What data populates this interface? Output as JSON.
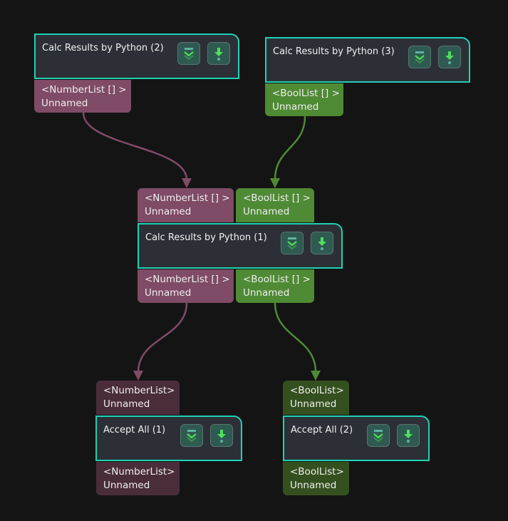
{
  "colors": {
    "background": "#141414",
    "node_fill": "#2c3036",
    "node_border": "#1fd1b5",
    "number_port": "#7f4b66",
    "bool_port": "#4f8a34",
    "number_port_muted": "#4a2d3a",
    "bool_port_muted": "#34501f",
    "number_edge": "#7f4b66",
    "bool_edge": "#4f8a34",
    "button_fill": "#2f5a51",
    "icon_green": "#4ee05a"
  },
  "nodes": {
    "calc2": {
      "title": "Calc Results by Python (2)",
      "buttons": [
        "collapse-icon",
        "download-icon"
      ],
      "outputs": [
        {
          "type": "<NumberList [] >",
          "name": "Unnamed"
        }
      ]
    },
    "calc3": {
      "title": "Calc Results by Python (3)",
      "buttons": [
        "collapse-icon",
        "download-icon"
      ],
      "outputs": [
        {
          "type": "<BoolList [] >",
          "name": "Unnamed"
        }
      ]
    },
    "calc1": {
      "title": "Calc Results by Python (1)",
      "buttons": [
        "collapse-icon",
        "download-icon"
      ],
      "inputs": [
        {
          "type": "<NumberList [] >",
          "name": "Unnamed"
        },
        {
          "type": "<BoolList [] >",
          "name": "Unnamed"
        }
      ],
      "outputs": [
        {
          "type": "<NumberList [] >",
          "name": "Unnamed"
        },
        {
          "type": "<BoolList [] >",
          "name": "Unnamed"
        }
      ]
    },
    "accept1": {
      "title": "Accept All (1)",
      "buttons": [
        "collapse-icon",
        "download-icon"
      ],
      "inputs": [
        {
          "type": "<NumberList>",
          "name": "Unnamed"
        }
      ],
      "outputs": [
        {
          "type": "<NumberList>",
          "name": "Unnamed"
        }
      ]
    },
    "accept2": {
      "title": "Accept All (2)",
      "buttons": [
        "collapse-icon",
        "download-icon"
      ],
      "inputs": [
        {
          "type": "<BoolList>",
          "name": "Unnamed"
        }
      ],
      "outputs": [
        {
          "type": "<BoolList>",
          "name": "Unnamed"
        }
      ]
    }
  },
  "edges": [
    {
      "from": "calc2.out.0",
      "to": "calc1.in.0",
      "kind": "number"
    },
    {
      "from": "calc3.out.0",
      "to": "calc1.in.1",
      "kind": "bool"
    },
    {
      "from": "calc1.out.0",
      "to": "accept1.in.0",
      "kind": "number"
    },
    {
      "from": "calc1.out.1",
      "to": "accept2.in.0",
      "kind": "bool"
    }
  ]
}
